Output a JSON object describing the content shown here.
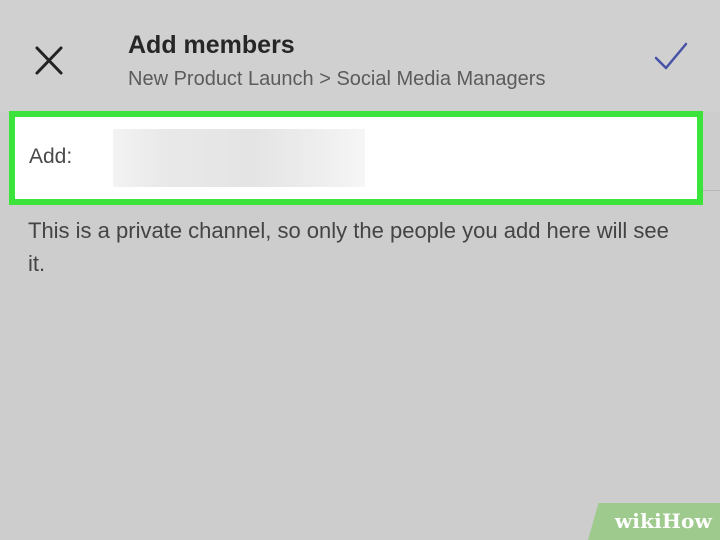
{
  "header": {
    "title": "Add members",
    "breadcrumb": "New Product Launch > Social Media Managers",
    "close_icon": "close-icon",
    "confirm_icon": "check-icon"
  },
  "add_field": {
    "label": "Add:",
    "value": ""
  },
  "info": {
    "text": "This is a private channel, so only the people you add here will see it."
  },
  "watermark": {
    "text": "wikiHow"
  },
  "colors": {
    "highlight": "#3be33b",
    "accent": "#4752a6"
  }
}
